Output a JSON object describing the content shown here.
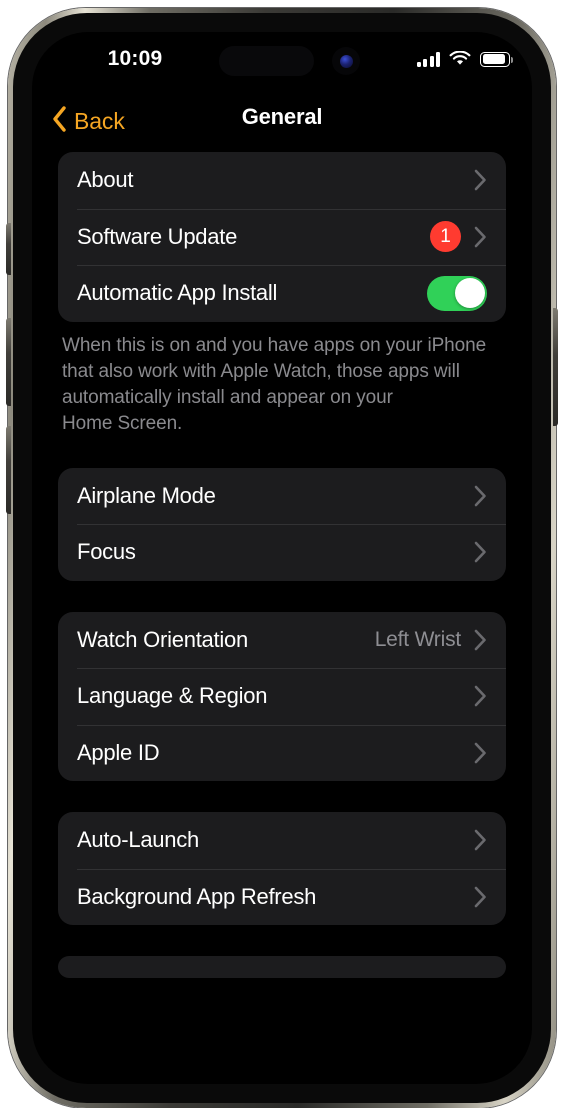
{
  "device": {
    "buttons": [
      "action-button",
      "volume-up-button",
      "volume-down-button",
      "power-button"
    ]
  },
  "status_bar": {
    "time": "10:09",
    "cellular_bars": 4,
    "wifi": "wifi-icon",
    "battery": "battery-full-icon",
    "battery_level_pct": 88
  },
  "nav": {
    "back_label": "Back",
    "title": "General"
  },
  "colors": {
    "accent": "#F5A623",
    "badge_red": "#FF3B30",
    "toggle_green": "#30D158",
    "card": "#1C1C1E",
    "screen_bg": "#000000",
    "secondary_text": "#8E8E93",
    "separator": "#323234"
  },
  "groups": [
    {
      "rows": [
        {
          "label": "About",
          "accessory": "chevron"
        },
        {
          "label": "Software Update",
          "accessory": "chevron",
          "badge": "1"
        },
        {
          "label": "Automatic App Install",
          "accessory": "toggle",
          "toggle_on": true
        }
      ],
      "footer": "When this is on and you have apps on your iPhone that also work with Apple Watch, those apps will automatically install and appear on your\nHome Screen."
    },
    {
      "rows": [
        {
          "label": "Airplane Mode",
          "accessory": "chevron"
        },
        {
          "label": "Focus",
          "accessory": "chevron"
        }
      ]
    },
    {
      "rows": [
        {
          "label": "Watch Orientation",
          "accessory": "chevron",
          "value": "Left Wrist"
        },
        {
          "label": "Language & Region",
          "accessory": "chevron"
        },
        {
          "label": "Apple ID",
          "accessory": "chevron"
        }
      ]
    },
    {
      "rows": [
        {
          "label": "Auto-Launch",
          "accessory": "chevron"
        },
        {
          "label": "Background App Refresh",
          "accessory": "chevron"
        }
      ]
    },
    {
      "partial": true,
      "rows": []
    }
  ]
}
